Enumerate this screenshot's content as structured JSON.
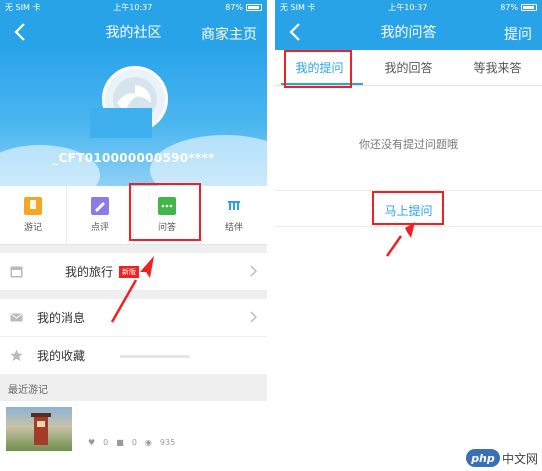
{
  "left": {
    "status": {
      "carrier": "无 SIM 卡",
      "time": "上午10:37",
      "battery": "87%"
    },
    "nav": {
      "title": "我的社区",
      "right_link": "商家主页"
    },
    "profile": {
      "username": "_CFT010000000590****"
    },
    "menu": [
      {
        "label": "游记",
        "icon": "travel-notes-icon",
        "color": "#f5a623"
      },
      {
        "label": "点评",
        "icon": "review-icon",
        "color": "#8c7ae6"
      },
      {
        "label": "问答",
        "icon": "qa-icon",
        "color": "#43b649"
      },
      {
        "label": "结伴",
        "icon": "companion-icon",
        "color": "#29a3e8"
      }
    ],
    "list": [
      {
        "label": "我的旅行",
        "icon": "calendar-icon",
        "badge": "新版"
      },
      {
        "label": "我的消息",
        "icon": "mail-icon"
      },
      {
        "label": "我的收藏",
        "icon": "star-icon"
      }
    ],
    "recent": {
      "heading": "最近游记",
      "likes": "0",
      "comments": "0",
      "views": "935"
    }
  },
  "right": {
    "status": {
      "carrier": "无 SIM 卡",
      "time": "上午10:37",
      "battery": "87%"
    },
    "nav": {
      "title": "我的问答",
      "right_link": "提问"
    },
    "tabs": [
      "我的提问",
      "我的回答",
      "等我来答"
    ],
    "empty_text": "你还没有提过问题哦",
    "ask_link": "马上提问"
  },
  "watermark": {
    "logo": "php",
    "text": "中文网"
  },
  "colors": {
    "brand": "#29a3e8",
    "highlight": "#e22222"
  }
}
